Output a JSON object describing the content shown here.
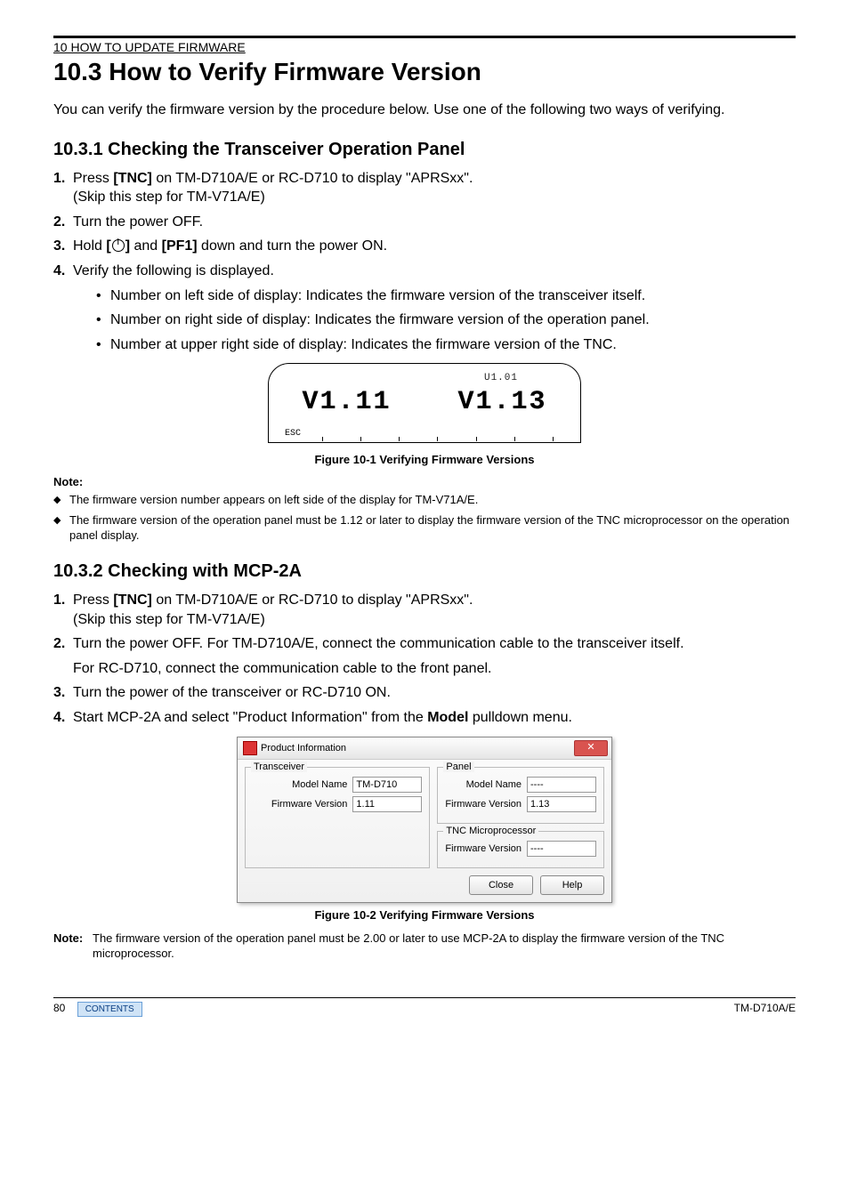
{
  "header": {
    "section_path": "10 HOW TO UPDATE FIRMWARE",
    "main_heading": "10.3  How to Verify Firmware Version",
    "intro": "You can verify the firmware version by the procedure below.  Use one of the following two ways of verifying."
  },
  "s1": {
    "heading": "10.3.1   Checking the Transceiver Operation Panel",
    "steps": {
      "s1a": "Press ",
      "s1b": "[TNC]",
      "s1c": " on TM-D710A/E or RC-D710 to display \"APRSxx\".",
      "s1d": "(Skip this step for TM-V71A/E)",
      "s2": "Turn the power OFF.",
      "s3a": "Hold ",
      "s3b": "[",
      "s3c": "]",
      "s3d": " and ",
      "s3e": "[PF1]",
      "s3f": " down and turn the power ON.",
      "s4": "Verify the following is displayed.",
      "b1": "Number on left side of display: Indicates the firmware version of the transceiver itself.",
      "b2": "Number on right side of display: Indicates the firmware version of the operation panel.",
      "b3": "Number at upper right side of display: Indicates the firmware version of the TNC."
    },
    "lcd": {
      "top": "U1.01",
      "left": "V1.11",
      "right": "V1.13",
      "esc": "ESC"
    },
    "fig_caption": "Figure 10-1   Verifying Firmware Versions",
    "note_label": "Note:",
    "notes": {
      "n1": "The firmware version number appears on left side of the display for TM-V71A/E.",
      "n2": "The firmware version of the operation panel must be 1.12 or later to display the firmware version of the TNC microprocessor on the operation panel display."
    }
  },
  "s2": {
    "heading": "10.3.2   Checking with MCP-2A",
    "steps": {
      "s1a": "Press ",
      "s1b": "[TNC]",
      "s1c": " on TM-D710A/E or RC-D710 to display \"APRSxx\".",
      "s1d": "(Skip this step for TM-V71A/E)",
      "s2": "Turn the power OFF.  For TM-D710A/E, connect the communication cable to the transceiver itself.",
      "s2b": "For RC-D710, connect the communication cable to the front panel.",
      "s3": "Turn the power of the transceiver or RC-D710 ON.",
      "s4a": "Start MCP-2A and select \"Product Information\" from the ",
      "s4b": "Model",
      "s4c": " pulldown menu."
    },
    "dialog": {
      "title": "Product Information",
      "transceiver_legend": "Transceiver",
      "panel_legend": "Panel",
      "tnc_legend": "TNC Microprocessor",
      "model_label": "Model Name",
      "fw_label": "Firmware Version",
      "tx_model": "TM-D710",
      "tx_fw": "1.11",
      "panel_model": "----",
      "panel_fw": "1.13",
      "tnc_fw": "----",
      "close": "Close",
      "help": "Help"
    },
    "fig_caption": "Figure 10-2   Verifying Firmware Versions",
    "note_label": "Note:",
    "note_text": "The firmware version of the operation panel must be 2.00 or later to use MCP-2A to display the firmware version of the TNC microprocessor."
  },
  "footer": {
    "page": "80",
    "contents": "CONTENTS",
    "model": "TM-D710A/E"
  }
}
